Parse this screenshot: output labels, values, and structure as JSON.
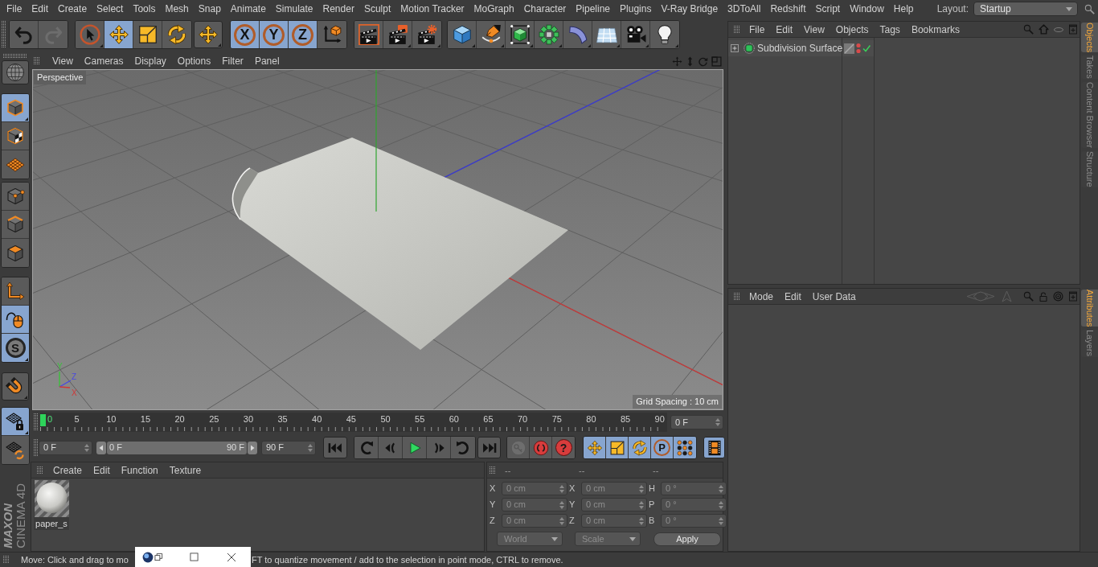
{
  "menu_bar": {
    "items": [
      "File",
      "Edit",
      "Create",
      "Select",
      "Tools",
      "Mesh",
      "Snap",
      "Animate",
      "Simulate",
      "Render",
      "Sculpt",
      "Motion Tracker",
      "MoGraph",
      "Character",
      "Pipeline",
      "Plugins",
      "V-Ray Bridge",
      "3DToAll",
      "Redshift",
      "Script",
      "Window",
      "Help"
    ],
    "layout": {
      "label": "Layout:",
      "value": "Startup"
    }
  },
  "main_toolbar": {
    "groups": [
      {
        "items": [
          {
            "kind": "undo",
            "disabled": false
          },
          {
            "kind": "redo",
            "disabled": true
          }
        ]
      },
      {
        "items": [
          {
            "kind": "select",
            "selected": false
          },
          {
            "kind": "move",
            "selected": true
          },
          {
            "kind": "scale",
            "selected": false
          },
          {
            "kind": "rotate",
            "selected": false
          }
        ]
      },
      {
        "items": [
          {
            "kind": "lasttool",
            "selected": false
          }
        ]
      },
      {
        "items": [
          {
            "kind": "axis",
            "label": "X",
            "selected": true
          },
          {
            "kind": "axis",
            "label": "Y",
            "selected": true
          },
          {
            "kind": "axis",
            "label": "Z",
            "selected": true
          },
          {
            "kind": "coords",
            "selected": false
          }
        ]
      },
      {
        "items": [
          {
            "kind": "renderview"
          },
          {
            "kind": "renderpv"
          },
          {
            "kind": "rendersettings"
          }
        ]
      },
      {
        "items": [
          {
            "kind": "cube"
          },
          {
            "kind": "pen"
          },
          {
            "kind": "subdivide"
          },
          {
            "kind": "cloner"
          },
          {
            "kind": "bend"
          },
          {
            "kind": "floor"
          },
          {
            "kind": "camera"
          },
          {
            "kind": "light"
          }
        ]
      }
    ]
  },
  "mode_toolbar": {
    "groups": [
      {
        "items": [
          {
            "kind": "editable",
            "selected": false
          }
        ]
      },
      {
        "items": [
          {
            "kind": "model",
            "selected": true
          },
          {
            "kind": "texture",
            "selected": false
          },
          {
            "kind": "workplane",
            "selected": false
          }
        ]
      },
      {
        "items": [
          {
            "kind": "points",
            "selected": false
          },
          {
            "kind": "edges",
            "selected": false
          },
          {
            "kind": "polygons",
            "selected": false
          }
        ]
      },
      {
        "items": [
          {
            "kind": "axismode",
            "selected": false
          },
          {
            "kind": "tweak",
            "selected": true
          },
          {
            "kind": "solo",
            "label": "S",
            "selected": true
          }
        ]
      },
      {
        "items": [
          {
            "kind": "snap",
            "selected": false
          }
        ]
      },
      {
        "items": [
          {
            "kind": "planelock",
            "selected": true
          },
          {
            "kind": "planealign",
            "selected": false
          }
        ]
      }
    ]
  },
  "logo": {
    "brand": "MAXON",
    "product": "CINEMA 4D"
  },
  "viewport": {
    "menu": [
      "View",
      "Cameras",
      "Display",
      "Options",
      "Filter",
      "Panel"
    ],
    "camera": "Perspective",
    "grid_spacing": "Grid Spacing : 10 cm",
    "gizmo": [
      "Y",
      "Z",
      "X"
    ]
  },
  "timeline": {
    "labels": [
      "0",
      "5",
      "10",
      "15",
      "20",
      "25",
      "30",
      "35",
      "40",
      "45",
      "50",
      "55",
      "60",
      "65",
      "70",
      "75",
      "80",
      "85",
      "90"
    ],
    "frame": "0 F"
  },
  "transport": {
    "start": "0 F",
    "range": {
      "start": "0 F",
      "end": "90 F",
      "level": 1
    },
    "end": "90 F",
    "groups": [
      {
        "items": [
          {
            "kind": "first"
          }
        ]
      },
      {
        "items": [
          {
            "kind": "prevkey"
          },
          {
            "kind": "prevframe"
          },
          {
            "kind": "play"
          },
          {
            "kind": "nextframe"
          },
          {
            "kind": "nextkey"
          }
        ]
      },
      {
        "items": [
          {
            "kind": "last"
          }
        ]
      },
      {
        "items": [
          {
            "kind": "recordactive",
            "disabled": true
          },
          {
            "kind": "autokey",
            "disabled": false
          },
          {
            "kind": "keyselect",
            "label": "?",
            "disabled": false
          }
        ]
      },
      {
        "items": [
          {
            "kind": "keypos",
            "selected": true
          },
          {
            "kind": "keyscale",
            "selected": true
          },
          {
            "kind": "keyrot",
            "selected": true
          },
          {
            "kind": "keyparam",
            "label": "P",
            "selected": true
          },
          {
            "kind": "keypla",
            "selected": true
          }
        ]
      },
      {
        "items": [
          {
            "kind": "timeline",
            "selected": true
          }
        ]
      }
    ]
  },
  "material_manager": {
    "menu": [
      "Create",
      "Edit",
      "Function",
      "Texture"
    ],
    "materials": [
      {
        "name": "paper_s"
      }
    ]
  },
  "coordinates": {
    "disabled": true,
    "headers": [
      "--",
      "--",
      "--"
    ],
    "rows": [
      [
        {
          "axis": "X",
          "value": "0 cm"
        },
        {
          "axis": "X",
          "value": "0 cm"
        },
        {
          "axis": "H",
          "value": "0 °"
        }
      ],
      [
        {
          "axis": "Y",
          "value": "0 cm"
        },
        {
          "axis": "Y",
          "value": "0 cm"
        },
        {
          "axis": "P",
          "value": "0 °"
        }
      ],
      [
        {
          "axis": "Z",
          "value": "0 cm"
        },
        {
          "axis": "Z",
          "value": "0 cm"
        },
        {
          "axis": "B",
          "value": "0 °"
        }
      ]
    ],
    "modes": [
      "World",
      "Scale"
    ],
    "apply": "Apply"
  },
  "status_bar": {
    "segments": [
      "Move: Click and drag to mo",
      "FT to quantize movement / add to the selection in point mode, CTRL to remove."
    ]
  },
  "object_manager": {
    "menu": [
      "File",
      "Edit",
      "View",
      "Objects",
      "Tags",
      "Bookmarks"
    ],
    "objects": [
      {
        "name": "Subdivision Surface",
        "expanded": false,
        "enabled": true
      }
    ]
  },
  "object_tabs": [
    {
      "label": "Objects",
      "selected": true
    },
    {
      "label": "Takes",
      "selected": false
    },
    {
      "label": "Content Browser",
      "selected": false
    },
    {
      "label": "Structure",
      "selected": false
    }
  ],
  "attribute_manager": {
    "menu": [
      "Mode",
      "Edit",
      "User Data"
    ]
  },
  "attribute_tabs": [
    {
      "label": "Attributes",
      "selected": true
    },
    {
      "label": "Layers",
      "selected": false
    }
  ]
}
